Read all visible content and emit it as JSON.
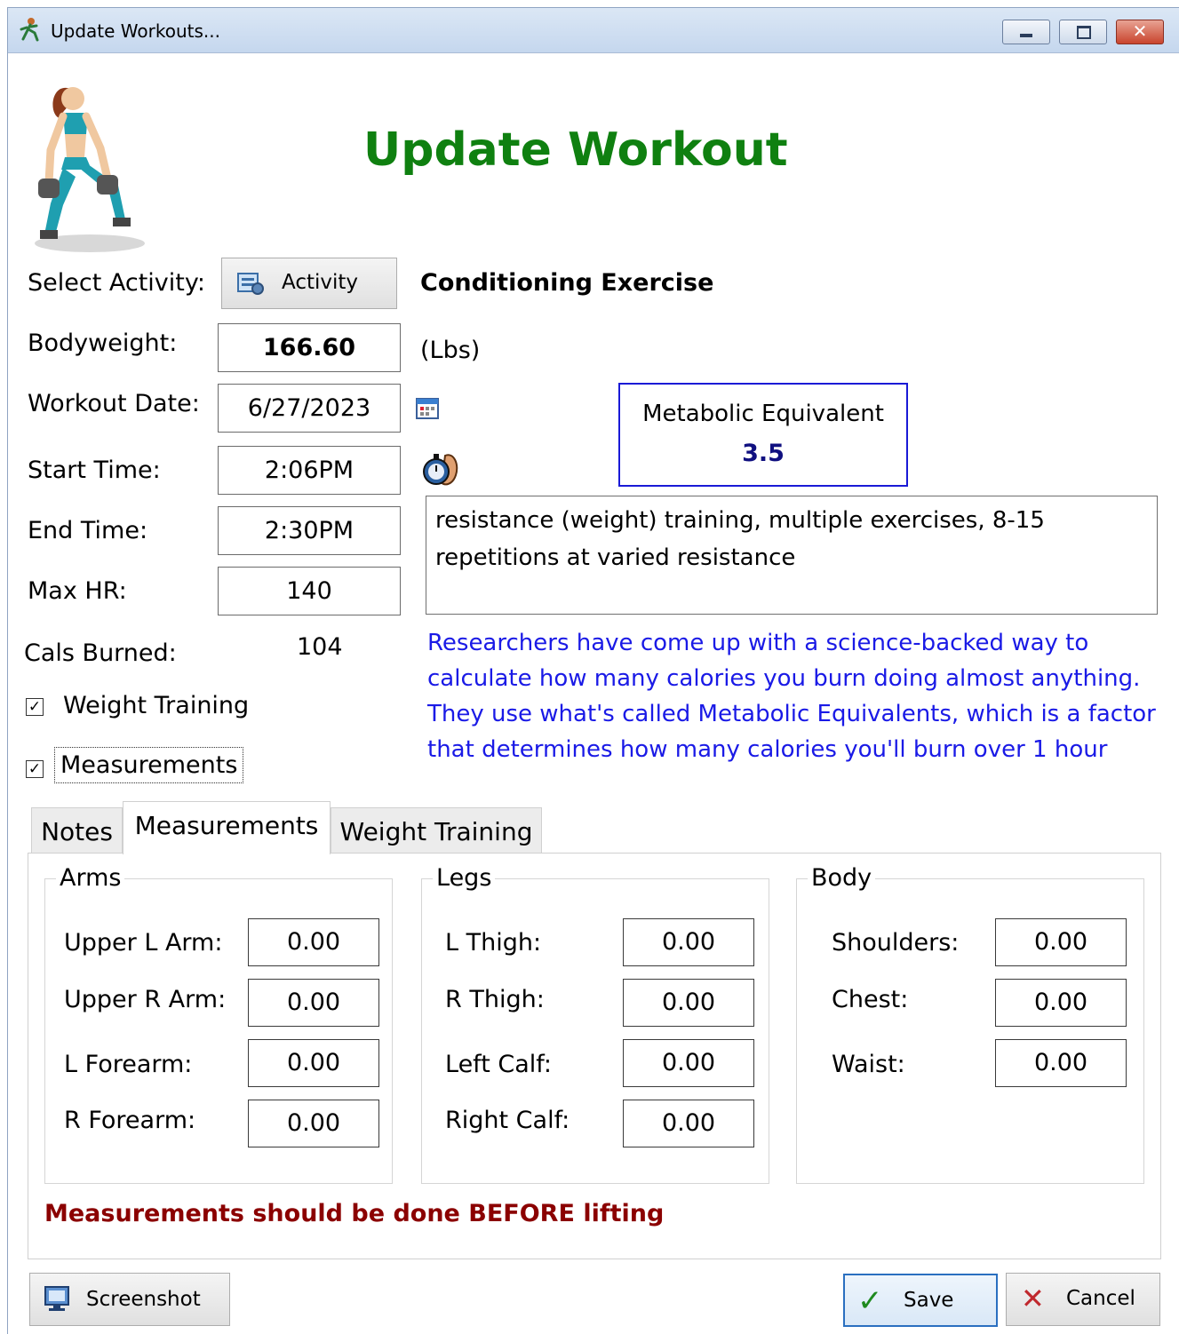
{
  "window": {
    "title": "Update Workouts...",
    "title_icon": "runner-icon",
    "controls": {
      "minimize_icon": "minimize-icon",
      "maximize_icon": "maximize-icon",
      "close_icon": "close-icon"
    }
  },
  "header": {
    "title": "Update Workout",
    "title_color": "#0f8010",
    "illustration": "woman-lifting-dumbbells"
  },
  "form": {
    "select_activity_label": "Select Activity:",
    "activity_button_label": "Activity",
    "activity_name": "Conditioning Exercise",
    "bodyweight_label": "Bodyweight:",
    "bodyweight_value": "166.60",
    "bodyweight_unit": "(Lbs)",
    "workout_date_label": "Workout Date:",
    "workout_date_value": "6/27/2023",
    "start_time_label": "Start Time:",
    "start_time_value": "2:06PM",
    "end_time_label": "End Time:",
    "end_time_value": "2:30PM",
    "max_hr_label": "Max HR:",
    "max_hr_value": "140",
    "cals_burned_label": "Cals Burned:",
    "cals_burned_value": "104",
    "weight_training_label": "Weight Training",
    "weight_training_checked": true,
    "measurements_label": "Measurements",
    "measurements_checked": true
  },
  "met": {
    "title": "Metabolic Equivalent",
    "value": "3.5",
    "border_color": "#1a1ad6",
    "value_color": "#101080"
  },
  "activity_description": "resistance (weight) training, multiple exercises, 8-15 repetitions at varied resistance",
  "info_text": "Researchers have come up with a science-backed way to calculate how many calories you burn doing almost anything. They use what's called Metabolic Equivalents, which is a factor that determines how many calories you'll burn over 1 hour",
  "info_color": "#1a1ae6",
  "tabs": [
    {
      "label": "Notes",
      "selected": false
    },
    {
      "label": "Measurements",
      "selected": true
    },
    {
      "label": "Weight Training",
      "selected": false
    }
  ],
  "measurements": {
    "arms": {
      "title": "Arms",
      "rows": [
        {
          "label": "Upper L Arm:",
          "value": "0.00"
        },
        {
          "label": "Upper R Arm:",
          "value": "0.00"
        },
        {
          "label": "L Forearm:",
          "value": "0.00"
        },
        {
          "label": "R Forearm:",
          "value": "0.00"
        }
      ]
    },
    "legs": {
      "title": "Legs",
      "rows": [
        {
          "label": "L Thigh:",
          "value": "0.00"
        },
        {
          "label": "R Thigh:",
          "value": "0.00"
        },
        {
          "label": "Left Calf:",
          "value": "0.00"
        },
        {
          "label": "Right Calf:",
          "value": "0.00"
        }
      ]
    },
    "body": {
      "title": "Body",
      "rows": [
        {
          "label": "Shoulders:",
          "value": "0.00"
        },
        {
          "label": "Chest:",
          "value": "0.00"
        },
        {
          "label": "Waist:",
          "value": "0.00"
        }
      ]
    },
    "warning": "Measurements should be done BEFORE lifting",
    "warning_color": "#8b0000"
  },
  "footer": {
    "screenshot_label": "Screenshot",
    "save_label": "Save",
    "cancel_label": "Cancel"
  }
}
